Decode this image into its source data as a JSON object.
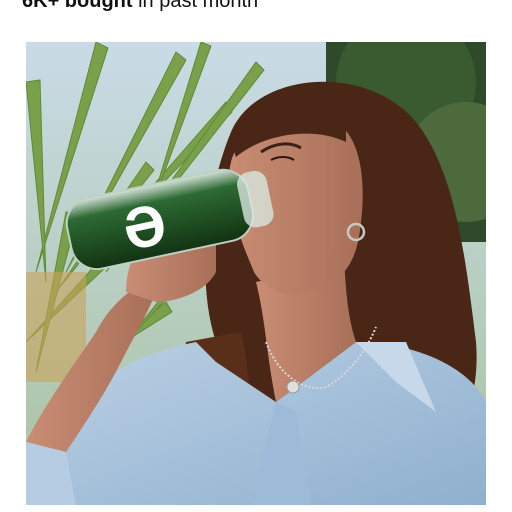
{
  "purchase_info": {
    "count": "6K+ bought",
    "suffix": "in past month"
  },
  "product_image": {
    "bottle_logo": "Ə"
  },
  "colors": {
    "text": "#0f1111",
    "shirt": "#a9c3dc",
    "juice_green": "#1f4a1f",
    "hair": "#4a2616",
    "skin": "#b9806a"
  },
  "icons": [
    "necklace-pendant",
    "hoop-earring"
  ]
}
